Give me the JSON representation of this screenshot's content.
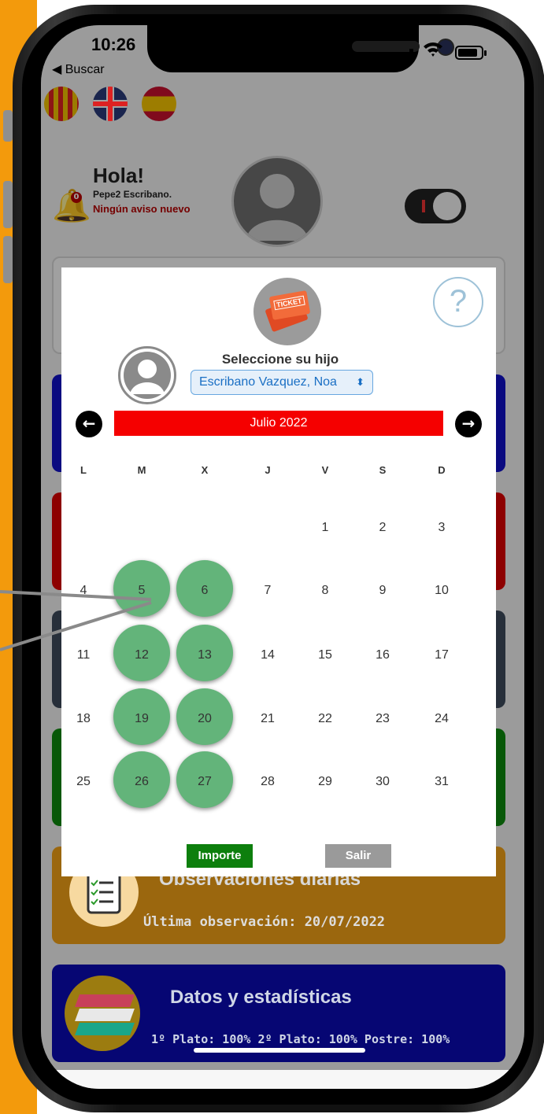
{
  "status_bar": {
    "time": "10:26",
    "back_label": "◀ Buscar"
  },
  "header": {
    "greeting": "Hola!",
    "user_name": "Pepe2 Escribano.",
    "notice": "Ningún aviso nuevo",
    "bell_badge": "0"
  },
  "language_flags": [
    "valenciano-flag-icon",
    "uk-flag-icon",
    "spain-flag-icon"
  ],
  "cards": {
    "observations": {
      "title": "Observaciones diarias",
      "last": "Última observación: 20/07/2022"
    },
    "stats": {
      "title": "Datos y estadísticas",
      "line": "1º Plato: 100% 2º Plato: 100% Postre: 100%"
    }
  },
  "modal": {
    "ticket_label": "TICKET",
    "help": "?",
    "select_label": "Seleccione su hijo",
    "selected_child": "Escribano Vazquez, Noa",
    "month": "Julio 2022",
    "prev_arrow": "←",
    "next_arrow": "→",
    "weekdays": [
      "L",
      "M",
      "X",
      "J",
      "V",
      "S",
      "D"
    ],
    "weeks": [
      [
        "",
        "",
        "",
        "",
        "1",
        "2",
        "3"
      ],
      [
        "4",
        "5",
        "6",
        "7",
        "8",
        "9",
        "10"
      ],
      [
        "11",
        "12",
        "13",
        "14",
        "15",
        "16",
        "17"
      ],
      [
        "18",
        "19",
        "20",
        "21",
        "22",
        "23",
        "24"
      ],
      [
        "25",
        "26",
        "27",
        "28",
        "29",
        "30",
        "31"
      ]
    ],
    "selected_days": [
      "5",
      "6",
      "12",
      "13",
      "19",
      "20",
      "26",
      "27"
    ],
    "importe_label": "Importe",
    "salir_label": "Salir"
  },
  "colors": {
    "accent_orange": "#f39a0c",
    "month_bar": "#f50000",
    "selected_day": "#63b47a",
    "importe": "#0d7f0d",
    "salir": "#9a9a9a"
  }
}
